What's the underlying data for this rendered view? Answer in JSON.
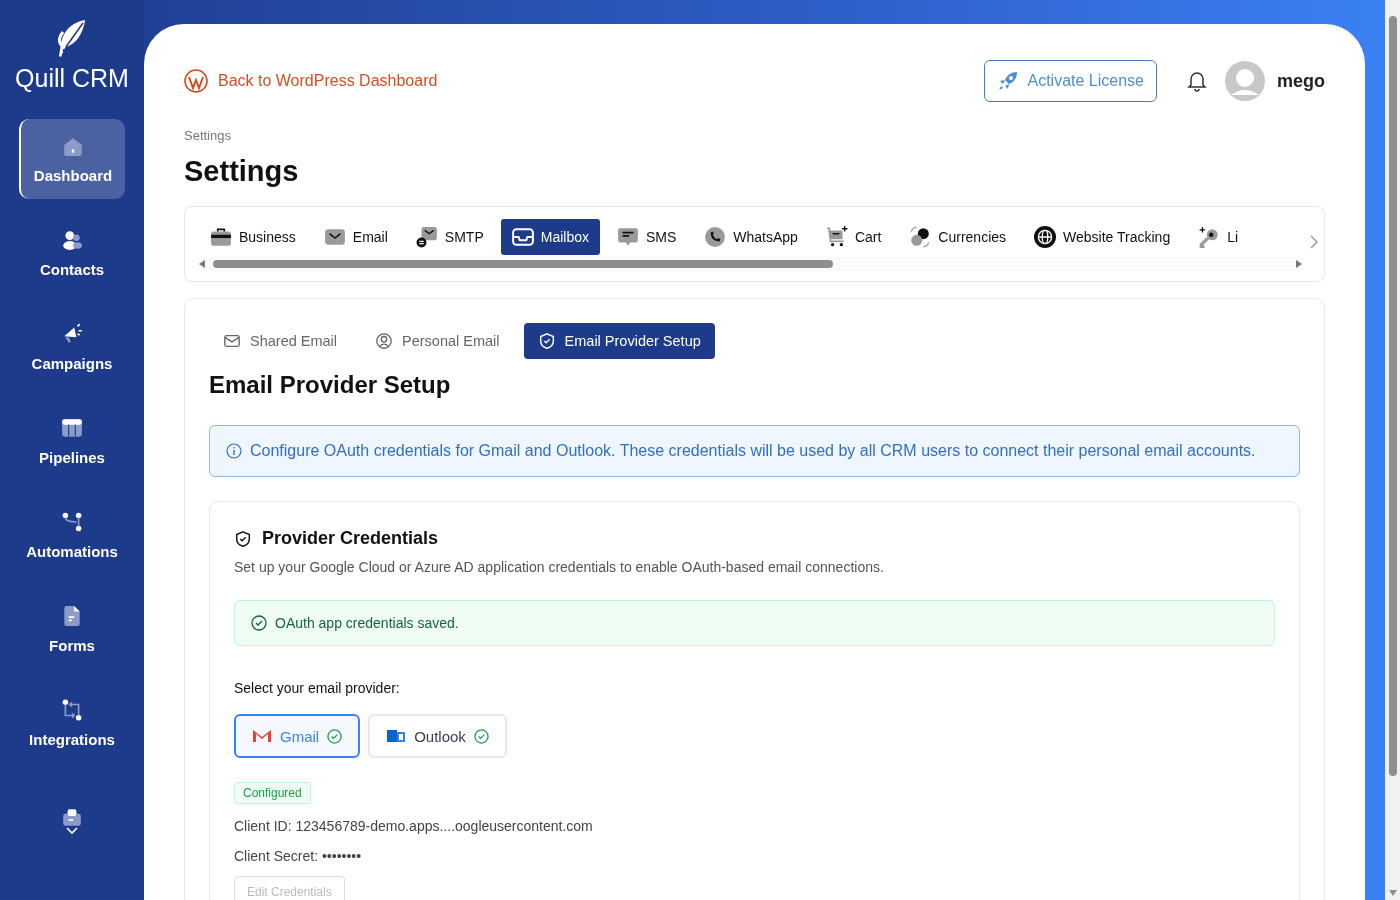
{
  "sidebar": {
    "brand": "Quill CRM",
    "items": [
      {
        "label": "Dashboard",
        "selected": true
      },
      {
        "label": "Contacts",
        "selected": false
      },
      {
        "label": "Campaigns",
        "selected": false
      },
      {
        "label": "Pipelines",
        "selected": false
      },
      {
        "label": "Automations",
        "selected": false
      },
      {
        "label": "Forms",
        "selected": false
      },
      {
        "label": "Integrations",
        "selected": false
      },
      {
        "selected": false
      }
    ]
  },
  "header": {
    "back_link": "Back to WordPress Dashboard",
    "license_button": "Activate License",
    "user": "mego"
  },
  "breadcrumb": "Settings",
  "title": "Settings",
  "tabs": [
    {
      "label": "Business",
      "selected": false
    },
    {
      "label": "Email",
      "selected": false
    },
    {
      "label": "SMTP",
      "selected": false
    },
    {
      "label": "Mailbox",
      "selected": true
    },
    {
      "label": "SMS",
      "selected": false
    },
    {
      "label": "WhatsApp",
      "selected": false
    },
    {
      "label": "Cart",
      "selected": false
    },
    {
      "label": "Currencies",
      "selected": false
    },
    {
      "label": "Website Tracking",
      "selected": false
    },
    {
      "label": "Li",
      "selected": false
    }
  ],
  "subtabs": [
    {
      "label": "Shared Email",
      "selected": false
    },
    {
      "label": "Personal Email",
      "selected": false
    },
    {
      "label": "Email Provider Setup",
      "selected": true
    }
  ],
  "section_title": "Email Provider Setup",
  "info": "Configure OAuth credentials for Gmail and Outlook. These credentials will be used by all CRM users to connect their personal email accounts.",
  "credentials": {
    "title": "Provider Credentials",
    "description": "Set up your Google Cloud or Azure AD application credentials to enable OAuth-based email connections.",
    "success": "OAuth app credentials saved.",
    "provider_label": "Select your email provider:",
    "providers": [
      {
        "label": "Gmail",
        "selected": true,
        "configured": true
      },
      {
        "label": "Outlook",
        "selected": false,
        "configured": true
      }
    ],
    "status_badge": "Configured",
    "client_id": "Client ID: 123456789-demo.apps....oogleusercontent.com",
    "client_secret": "Client Secret: ••••••••",
    "edit_button": "Edit Credentials"
  }
}
